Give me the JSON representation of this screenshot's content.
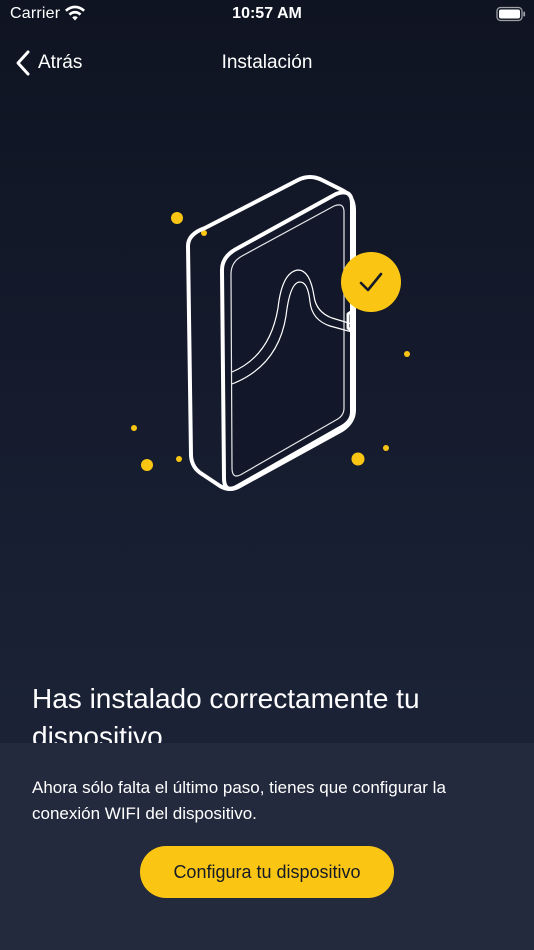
{
  "status_bar": {
    "carrier": "Carrier",
    "time": "10:57 AM"
  },
  "nav": {
    "back_label": "Atrás",
    "title": "Instalación"
  },
  "content": {
    "headline": "Has instalado correctamente tu dispositivo",
    "description": "Ahora sólo falta el último paso, tienes que configurar la conexión WIFI del dispositivo.",
    "cta_label": "Configura tu dispositivo"
  },
  "colors": {
    "accent": "#fbc613",
    "background_top": "#0f1422",
    "background_bottom": "#1f263a",
    "card": "#242a3e"
  },
  "icons": {
    "wifi": "wifi-icon",
    "battery": "battery-icon",
    "back": "chevron-left-icon",
    "device": "device-illustration",
    "check": "checkmark-icon"
  }
}
